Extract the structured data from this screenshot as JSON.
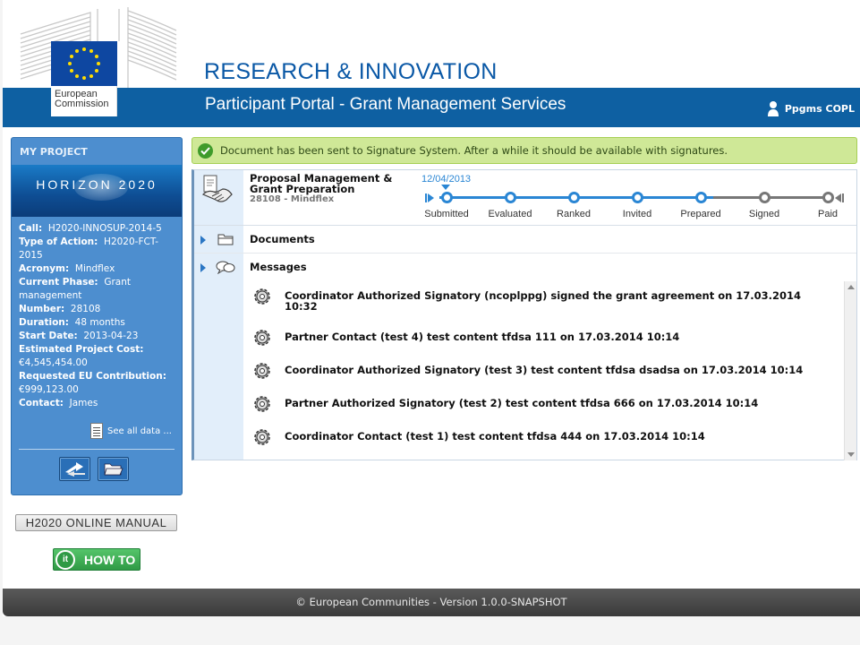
{
  "header": {
    "logo_line1": "European",
    "logo_line2": "Commission",
    "title": "RESEARCH & INNOVATION",
    "portal_title": "Participant Portal - Grant Management Services",
    "user_name": "Ppgms COPL",
    "colors": {
      "header_bar": "#0e60a2",
      "title": "#0a58a6"
    }
  },
  "sidebar": {
    "heading": "MY PROJECT",
    "banner_text": "HORIZON 2020",
    "fields": [
      {
        "label": "Call:",
        "value": "H2020-INNOSUP-2014-5"
      },
      {
        "label": "Type of Action:",
        "value": "H2020-FCT-2015"
      },
      {
        "label": "Acronym:",
        "value": "Mindflex"
      },
      {
        "label": "Current Phase:",
        "value": "Grant management"
      },
      {
        "label": "Number:",
        "value": "28108"
      },
      {
        "label": "Duration:",
        "value": "48 months"
      },
      {
        "label": "Start Date:",
        "value": "2013-04-23"
      },
      {
        "label": "Estimated Project Cost:",
        "value": "€4,545,454.00"
      },
      {
        "label": "Requested EU Contribution:",
        "value": "€999,123.00"
      },
      {
        "label": "Contact:",
        "value": "James"
      }
    ],
    "see_all": "See all data ...",
    "manual_button": "H2020 ONLINE MANUAL",
    "howto_button": "HOW TO"
  },
  "alert": {
    "text": "Document has been sent to Signature System. After a while it should be available with signatures."
  },
  "proposal": {
    "title": "Proposal Management & Grant Preparation",
    "subtitle": "28108 - Mindflex",
    "current_date": "12/04/2013",
    "steps": [
      {
        "label": "Submitted",
        "done": true
      },
      {
        "label": "Evaluated",
        "done": true
      },
      {
        "label": "Ranked",
        "done": true
      },
      {
        "label": "Invited",
        "done": true
      },
      {
        "label": "Prepared",
        "done": true
      },
      {
        "label": "Signed",
        "done": false
      },
      {
        "label": "Paid",
        "done": false
      }
    ]
  },
  "sections": {
    "documents": "Documents",
    "messages": "Messages"
  },
  "messages": [
    "Coordinator Authorized Signatory (ncoplppg) signed the grant agreement on 17.03.2014 10:32",
    "Partner Contact (test 4) test content tfdsa 111 on 17.03.2014 10:14",
    "Coordinator Authorized Signatory (test 3) test content tfdsa dsadsa on 17.03.2014 10:14",
    "Partner Authorized Signatory (test 2) test content tfdsa 666 on 17.03.2014 10:14",
    "Coordinator Contact (test 1) test content tfdsa 444 on 17.03.2014 10:14"
  ],
  "footer": {
    "text": "© European Communities - Version 1.0.0-SNAPSHOT"
  }
}
